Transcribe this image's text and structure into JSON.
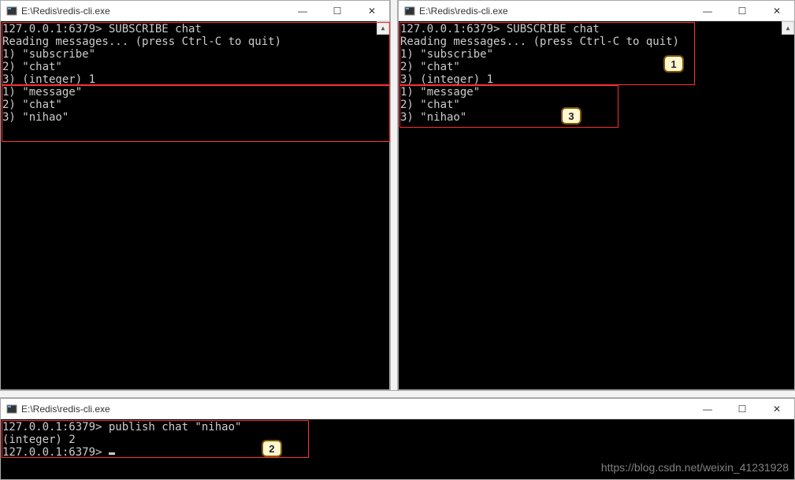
{
  "windows": {
    "top_left": {
      "title": "E:\\Redis\\redis-cli.exe",
      "lines": [
        "127.0.0.1:6379> SUBSCRIBE chat",
        "Reading messages... (press Ctrl-C to quit)",
        "1) \"subscribe\"",
        "2) \"chat\"",
        "3) (integer) 1",
        "1) \"message\"",
        "2) \"chat\"",
        "3) \"nihao\""
      ]
    },
    "top_right": {
      "title": "E:\\Redis\\redis-cli.exe",
      "lines": [
        "127.0.0.1:6379> SUBSCRIBE chat",
        "Reading messages... (press Ctrl-C to quit)",
        "1) \"subscribe\"",
        "2) \"chat\"",
        "3) (integer) 1",
        "1) \"message\"",
        "2) \"chat\"",
        "3) \"nihao\""
      ]
    },
    "bottom": {
      "title": "E:\\Redis\\redis-cli.exe",
      "lines": [
        "127.0.0.1:6379> publish chat \"nihao\"",
        "(integer) 2",
        "127.0.0.1:6379> "
      ]
    }
  },
  "buttons": {
    "minimize": "—",
    "maximize": "☐",
    "close": "✕"
  },
  "annotations": {
    "label1": "1",
    "label2": "2",
    "label3": "3"
  },
  "watermark": "https://blog.csdn.net/weixin_41231928"
}
